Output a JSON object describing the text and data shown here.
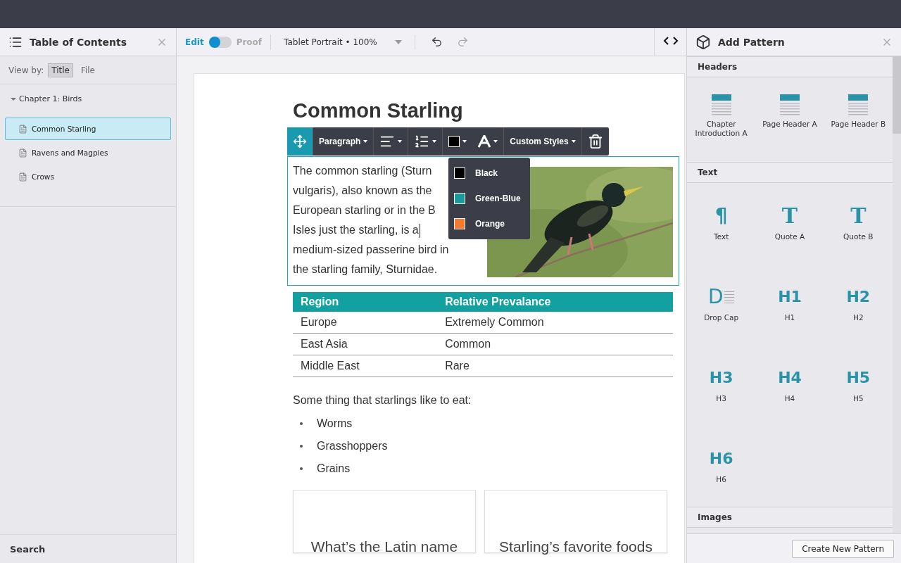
{
  "toc": {
    "title": "Table of Contents",
    "view_by": {
      "label": "View by:",
      "options": [
        {
          "label": "Title",
          "selected": true
        },
        {
          "label": "File",
          "selected": false
        }
      ]
    },
    "tree": [
      {
        "label": "Chapter 1: Birds",
        "expanded": true,
        "children": [
          {
            "label": "Common Starling",
            "selected": true
          },
          {
            "label": "Ravens and Magpies",
            "selected": false
          },
          {
            "label": "Crows",
            "selected": false
          }
        ]
      }
    ],
    "search": "Search"
  },
  "toolbar": {
    "edit_label": "Edit",
    "proof_label": "Proof",
    "proof_on": false,
    "device": "Tablet Portrait • 100%",
    "undo_disabled": false,
    "redo_disabled": true
  },
  "format_bar": {
    "style": "Paragraph",
    "current_color": {
      "color": "#000000"
    },
    "custom": "Custom Styles"
  },
  "color_menu": [
    {
      "label": "Black",
      "color": "#000000"
    },
    {
      "label": "Green-Blue",
      "color": "#1a9a9a"
    },
    {
      "label": "Orange",
      "color": "#f47a32"
    }
  ],
  "document": {
    "heading": "Common Starling",
    "paragraph_lines": [
      "The common starling (Sturn",
      "vulgaris), also known as the",
      "European starling or in the B",
      "Isles just the starling, is a",
      "medium-sized passerine bird in",
      "the starling family, Sturnidae."
    ],
    "picture": {
      "kind": "picture"
    },
    "table": {
      "columns": [
        "Region",
        "Relative Prevalance"
      ],
      "rows": [
        [
          "Europe",
          "Extremely Common"
        ],
        [
          "East Asia",
          "Common"
        ],
        [
          "Middle East",
          "Rare"
        ]
      ]
    },
    "intro": "Some thing that starlings like to eat:",
    "list": [
      "Worms",
      "Grasshoppers",
      "Grains"
    ],
    "cards": [
      "What’s the Latin name",
      "Starling’s favorite foods"
    ]
  },
  "patterns": {
    "title": "Add Pattern",
    "sections": [
      {
        "title": "Headers",
        "items": [
          {
            "kind": "header",
            "label": "Chapter Introduction A"
          },
          {
            "kind": "header",
            "label": "Page Header A"
          },
          {
            "kind": "header",
            "label": "Page Header B"
          }
        ]
      },
      {
        "title": "Text",
        "items": [
          {
            "kind": "glyph",
            "glyph": "¶",
            "label": "Text"
          },
          {
            "kind": "serif",
            "glyph": "T",
            "label": "Quote A"
          },
          {
            "kind": "serif",
            "glyph": "T",
            "label": "Quote B"
          },
          {
            "kind": "dropcap",
            "glyph": "D",
            "label": "Drop Cap"
          },
          {
            "kind": "heading",
            "glyph": "H1",
            "label": "H1"
          },
          {
            "kind": "heading",
            "glyph": "H2",
            "label": "H2"
          },
          {
            "kind": "heading",
            "glyph": "H3",
            "label": "H3"
          },
          {
            "kind": "heading",
            "glyph": "H4",
            "label": "H4"
          },
          {
            "kind": "heading",
            "glyph": "H5",
            "label": "H5"
          },
          {
            "kind": "heading",
            "glyph": "H6",
            "label": "H6"
          }
        ]
      },
      {
        "title": "Images"
      }
    ],
    "create_button": "Create New Pattern"
  }
}
